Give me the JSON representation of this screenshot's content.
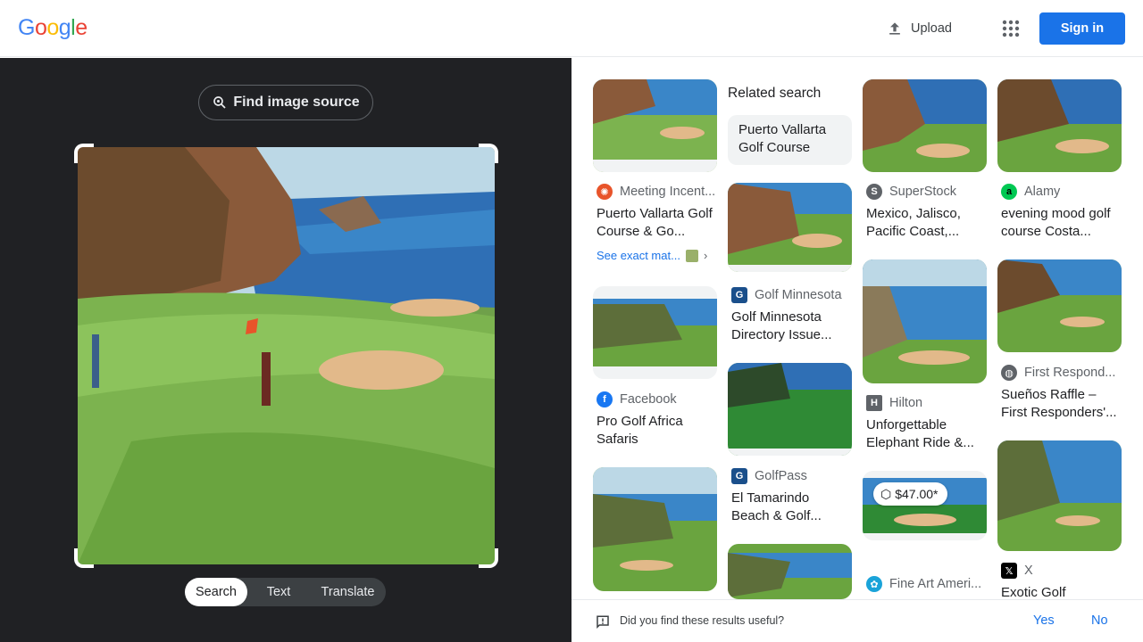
{
  "header": {
    "logo_letters": [
      "G",
      "o",
      "o",
      "g",
      "l",
      "e"
    ],
    "logo_colors": [
      "#4285f4",
      "#ea4335",
      "#fbbc05",
      "#4285f4",
      "#34a853",
      "#ea4335"
    ],
    "upload_label": "Upload",
    "signin_label": "Sign in",
    "apps_icon": "apps-grid-icon"
  },
  "lens": {
    "find_source_label": "Find image source",
    "modes": [
      "Search",
      "Text",
      "Translate"
    ],
    "active_mode": "Search"
  },
  "results": {
    "related_heading": "Related search",
    "related_chip": "Puerto Vallarta Golf Course",
    "see_exact": "See exact mat...",
    "price": "$47.00*",
    "items": [
      {
        "source": "Meeting Incent...",
        "title": "Puerto Vallarta Golf Course & Go...",
        "icon": "meeting-incentives-icon",
        "color": "#e8542a"
      },
      {
        "source": "SuperStock",
        "title": "Mexico, Jalisco, Pacific Coast,...",
        "icon": "superstock-icon",
        "color": "#5f6368"
      },
      {
        "source": "Alamy",
        "title": "evening mood golf course Costa...",
        "icon": "alamy-icon",
        "color": "#00c853"
      },
      {
        "source": "Golf Minnesota",
        "title": "Golf Minnesota Directory Issue...",
        "icon": "golf-minnesota-icon",
        "color": "#1a4f8b"
      },
      {
        "source": "Facebook",
        "title": "Pro Golf Africa Safaris",
        "icon": "facebook-icon",
        "color": "#1877f2"
      },
      {
        "source": "Hilton",
        "title": "Unforgettable Elephant Ride &...",
        "icon": "hilton-icon",
        "color": "#5f6368"
      },
      {
        "source": "First Respond...",
        "title": "Sueños Raffle – First Responders'...",
        "icon": "globe-icon",
        "color": "#5f6368"
      },
      {
        "source": "GolfPass",
        "title": "El Tamarindo Beach & Golf...",
        "icon": "golfpass-icon",
        "color": "#1a4f8b"
      },
      {
        "source": "Fine Art Ameri...",
        "title": "",
        "icon": "fine-art-america-icon",
        "color": "#1aa3d9"
      },
      {
        "source": "X",
        "title": "Exotic Golf",
        "icon": "x-icon",
        "color": "#000000"
      }
    ]
  },
  "feedback": {
    "question": "Did you find these results useful?",
    "yes": "Yes",
    "no": "No"
  }
}
